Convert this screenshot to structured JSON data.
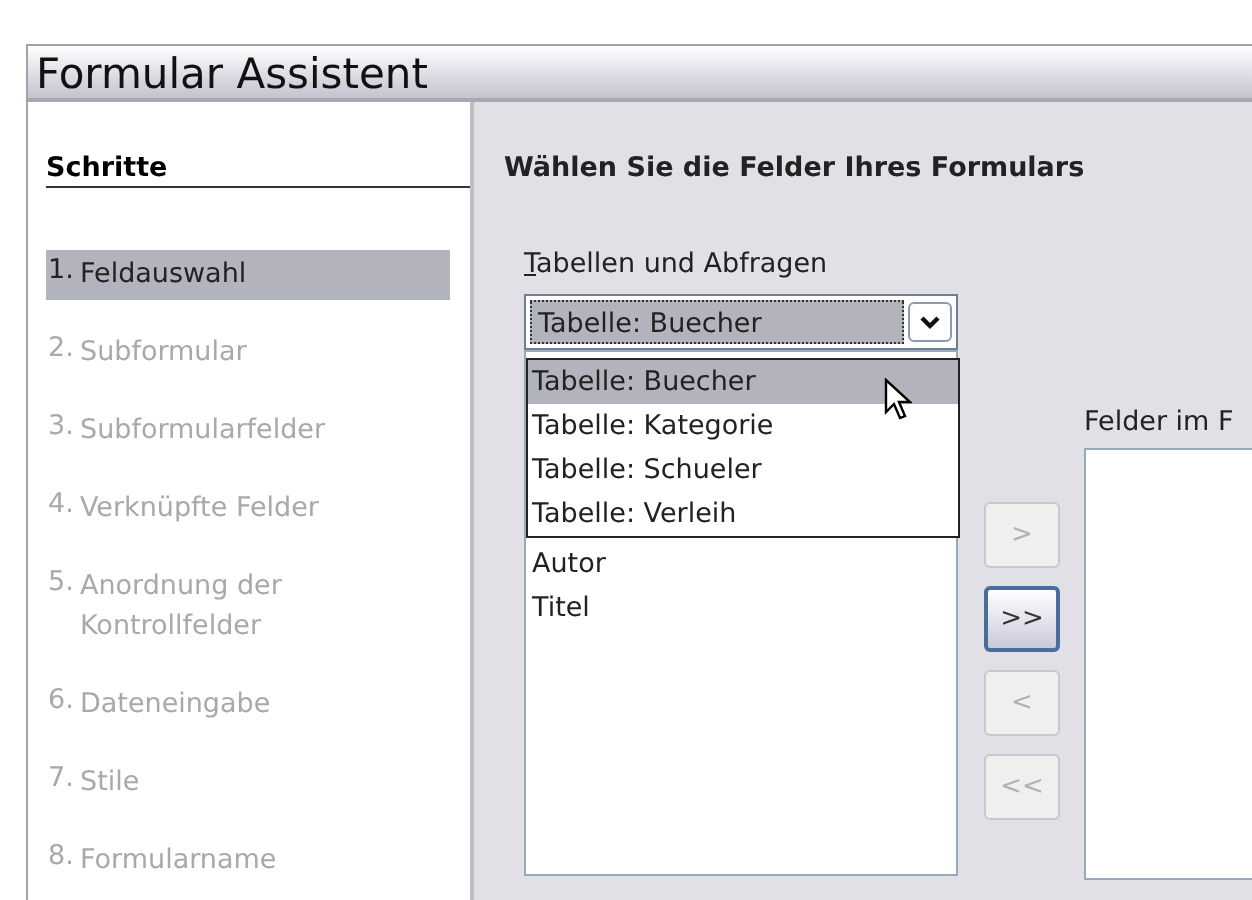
{
  "window": {
    "title": "Formular Assistent"
  },
  "sidebar": {
    "heading": "Schritte",
    "steps": [
      {
        "number": "1.",
        "label": "Feldauswahl",
        "selected": true,
        "disabled": false
      },
      {
        "number": "2.",
        "label": "Subformular",
        "selected": false,
        "disabled": true
      },
      {
        "number": "3.",
        "label": "Subformularfelder",
        "selected": false,
        "disabled": true
      },
      {
        "number": "4.",
        "label": "Verknüpfte Felder",
        "selected": false,
        "disabled": true
      },
      {
        "number": "5.",
        "label": "Anordnung der Kontrollfelder",
        "selected": false,
        "disabled": true
      },
      {
        "number": "6.",
        "label": "Dateneingabe",
        "selected": false,
        "disabled": true
      },
      {
        "number": "7.",
        "label": "Stile",
        "selected": false,
        "disabled": true
      },
      {
        "number": "8.",
        "label": "Formularname",
        "selected": false,
        "disabled": true
      }
    ]
  },
  "content": {
    "heading": "Wählen Sie die Felder Ihres Formulars",
    "tables_label": "Tabellen und Abfragen",
    "tables_combo": {
      "value": "Tabelle: Buecher",
      "expanded": true,
      "options": [
        {
          "label": "Tabelle: Buecher",
          "selected": true
        },
        {
          "label": "Tabelle: Kategorie",
          "selected": false
        },
        {
          "label": "Tabelle: Schueler",
          "selected": false
        },
        {
          "label": "Tabelle: Verleih",
          "selected": false
        }
      ]
    },
    "available_fields": [
      "Autor",
      "Titel"
    ],
    "move_buttons": [
      {
        "label": ">",
        "disabled": true,
        "focused": false
      },
      {
        "label": ">>",
        "disabled": false,
        "focused": true
      },
      {
        "label": "<",
        "disabled": true,
        "focused": false
      },
      {
        "label": "<<",
        "disabled": true,
        "focused": false
      }
    ],
    "form_fields_label": "Felder im F"
  }
}
